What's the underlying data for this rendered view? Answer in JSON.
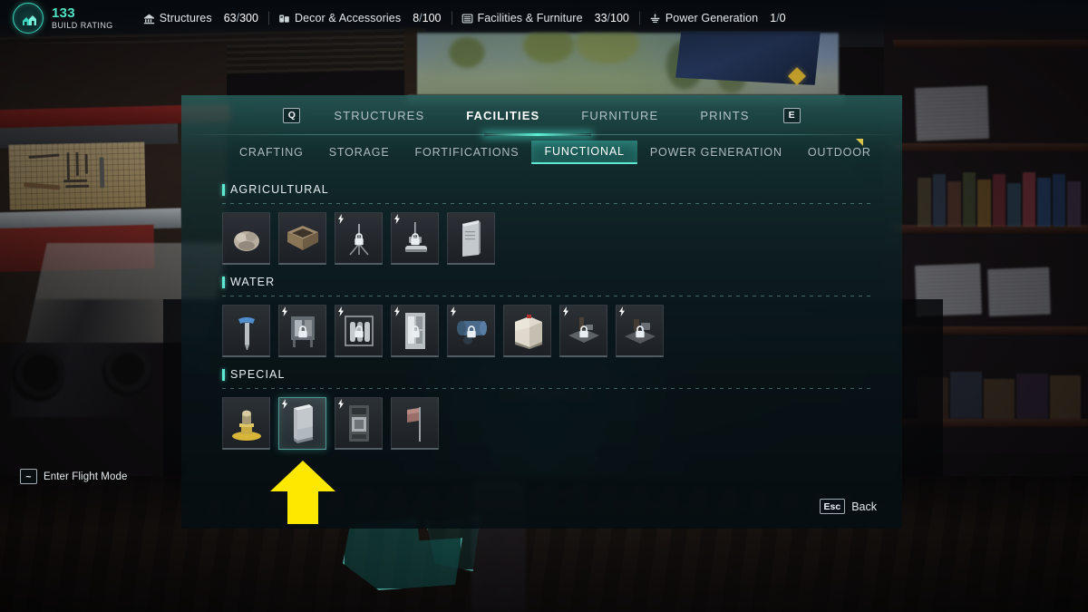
{
  "hud": {
    "build_rating": {
      "value": "133",
      "label": "BUILD RATING",
      "icon": "house-rating-icon",
      "color": "#4fe3c6"
    },
    "counters": [
      {
        "icon": "structures-icon",
        "name": "Structures",
        "current": "63",
        "separator": "/",
        "max": "300"
      },
      {
        "icon": "decor-icon",
        "name": "Decor & Accessories",
        "current": "8",
        "separator": "/",
        "max": "100"
      },
      {
        "icon": "facilities-icon",
        "name": "Facilities & Furniture",
        "current": "33",
        "separator": "/",
        "max": "100"
      },
      {
        "icon": "power-icon",
        "name": "Power Generation",
        "current": "1",
        "separator": "/",
        "max": "0"
      }
    ]
  },
  "panel": {
    "prev_key": "Q",
    "next_key": "E",
    "main_tabs": [
      {
        "label": "STRUCTURES",
        "active": false
      },
      {
        "label": "FACILITIES",
        "active": true
      },
      {
        "label": "FURNITURE",
        "active": false
      },
      {
        "label": "PRINTS",
        "active": false
      }
    ],
    "sub_tabs": [
      {
        "label": "CRAFTING",
        "active": false
      },
      {
        "label": "STORAGE",
        "active": false
      },
      {
        "label": "FORTIFICATIONS",
        "active": false
      },
      {
        "label": "FUNCTIONAL",
        "active": true
      },
      {
        "label": "POWER GENERATION",
        "active": false
      },
      {
        "label": "OUTDOOR",
        "active": false
      }
    ],
    "sections": [
      {
        "title": "AGRICULTURAL",
        "items": [
          {
            "thumb": "compost-pile",
            "powered": false,
            "locked": false,
            "selected": false
          },
          {
            "thumb": "planter-box",
            "powered": false,
            "locked": false,
            "selected": false
          },
          {
            "thumb": "irrigation-sprinkler",
            "powered": true,
            "locked": true,
            "selected": false
          },
          {
            "thumb": "hanging-grow-lamp",
            "powered": true,
            "locked": true,
            "selected": false
          },
          {
            "thumb": "grow-cabinet",
            "powered": false,
            "locked": false,
            "selected": false
          }
        ]
      },
      {
        "title": "WATER",
        "items": [
          {
            "thumb": "water-pump-spigot",
            "powered": false,
            "locked": false,
            "selected": false
          },
          {
            "thumb": "water-filter-unit",
            "powered": true,
            "locked": true,
            "selected": false
          },
          {
            "thumb": "water-tank-rack",
            "powered": true,
            "locked": true,
            "selected": false
          },
          {
            "thumb": "purifier-cabinet",
            "powered": true,
            "locked": true,
            "selected": false
          },
          {
            "thumb": "pressure-tank",
            "powered": true,
            "locked": true,
            "selected": false
          },
          {
            "thumb": "ibc-tote-tank",
            "powered": false,
            "locked": false,
            "selected": false
          },
          {
            "thumb": "well-pump-small",
            "powered": true,
            "locked": true,
            "selected": false
          },
          {
            "thumb": "well-pump-large",
            "powered": true,
            "locked": true,
            "selected": false
          }
        ]
      },
      {
        "title": "SPECIAL",
        "items": [
          {
            "thumb": "gold-pedestal-trophy",
            "powered": false,
            "locked": false,
            "selected": false
          },
          {
            "thumb": "glass-display-case",
            "powered": true,
            "locked": false,
            "selected": true
          },
          {
            "thumb": "vending-terminal",
            "powered": true,
            "locked": false,
            "selected": false
          },
          {
            "thumb": "banner-flag",
            "powered": false,
            "locked": false,
            "selected": false
          }
        ]
      }
    ],
    "footer": {
      "key": "Esc",
      "label": "Back"
    }
  },
  "hints": {
    "flight_mode": {
      "key": "~",
      "label": "Enter Flight Mode"
    }
  },
  "annotation": {
    "type": "arrow-up",
    "color": "#FFE800",
    "points_at": "glass-display-case"
  },
  "theme": {
    "accent": "#5fe9d2",
    "panel_tint": "#1e5654",
    "highlight": "#ffffff"
  }
}
